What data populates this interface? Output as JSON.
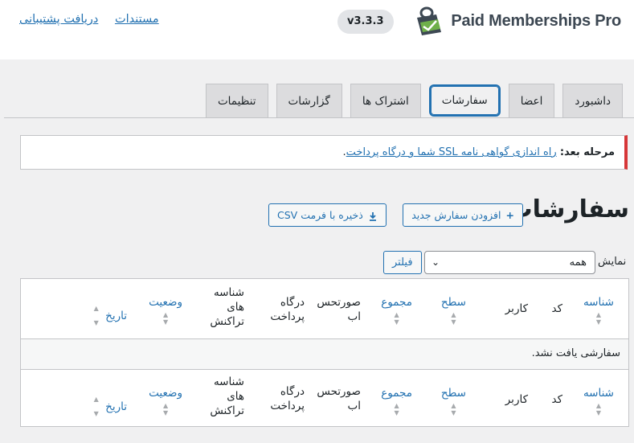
{
  "header": {
    "brand_name": "Paid Memberships Pro",
    "version": "v3.3.3",
    "links": [
      "مستندات",
      "دریافت پشتیبانی"
    ]
  },
  "tabs": [
    {
      "label": "داشبورد",
      "active": false
    },
    {
      "label": "اعضا",
      "active": false
    },
    {
      "label": "سفارشات",
      "active": true
    },
    {
      "label": "اشتراک ها",
      "active": false
    },
    {
      "label": "گزارشات",
      "active": false
    },
    {
      "label": "تنظیمات",
      "active": false
    }
  ],
  "notice": {
    "label": "مرحله بعد:",
    "link": "راه اندازی گواهی نامه SSL شما و درگاه پرداخت",
    "suffix": "."
  },
  "page": {
    "title": "سفارشات",
    "add_button": "افزودن سفارش جدید",
    "add_icon": "+",
    "csv_button": "ذخیره با فرمت CSV",
    "csv_icon": "download-icon"
  },
  "filter": {
    "label": "نمایش",
    "selected": "همه",
    "button": "فیلتر"
  },
  "table": {
    "columns": {
      "id": "شناسه",
      "code": "کد",
      "user": "کاربر",
      "level": "سطح",
      "total": "مجموع",
      "invoice_1": "صورتحس",
      "invoice_2": "اب",
      "gateway_1": "درگاه",
      "gateway_2": "پرداخت",
      "txn_1": "شناسه",
      "txn_2": "های",
      "txn_3": "تراکنش",
      "status": "وضعیت",
      "date": "تاریخ"
    },
    "empty_message": "سفارشی یافت نشد."
  },
  "colors": {
    "accent": "#2271b1",
    "notice_border": "#d63638",
    "background": "#f0f0f1"
  }
}
